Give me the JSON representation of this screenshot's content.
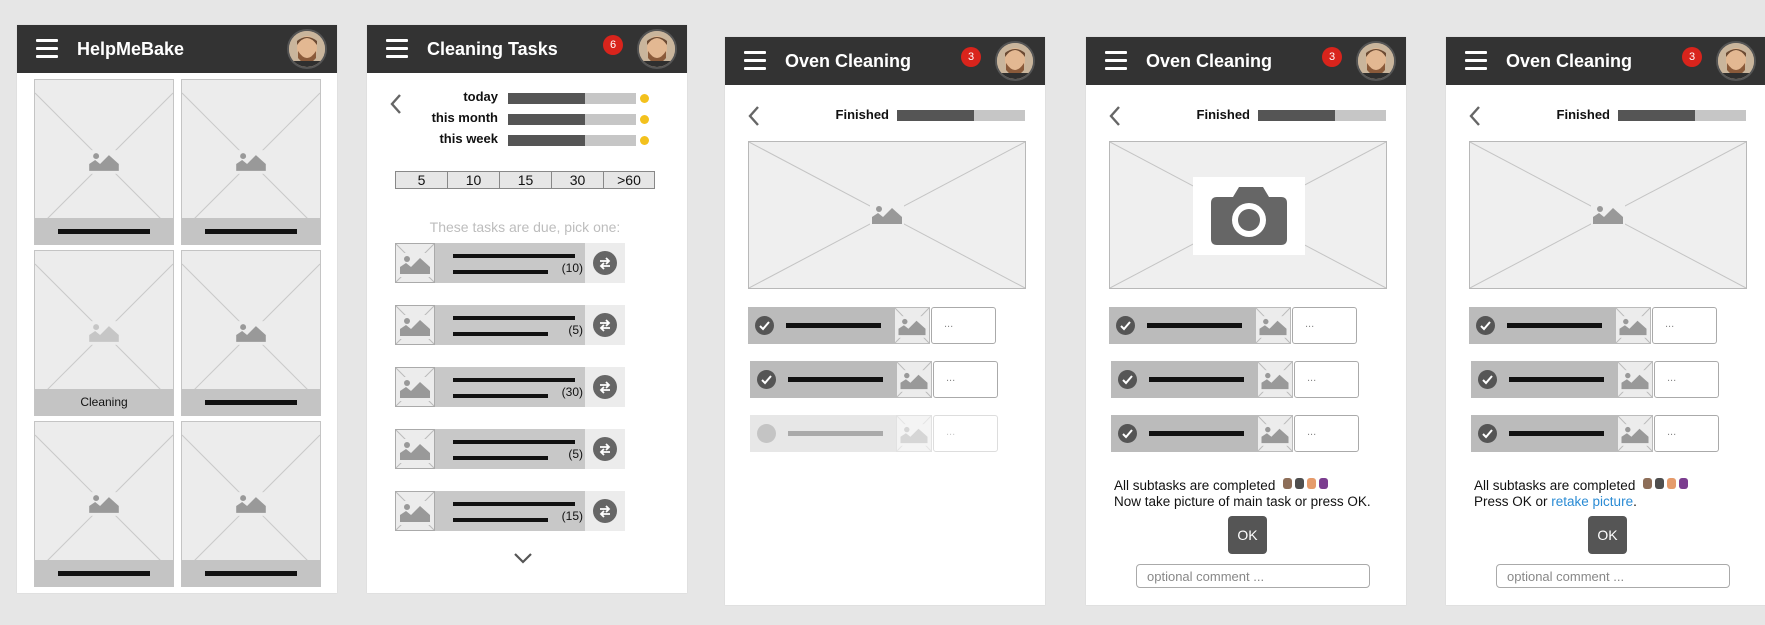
{
  "screen1": {
    "title": "HelpMeBake",
    "tiles": [
      {
        "caption": ""
      },
      {
        "caption": ""
      },
      {
        "caption": "Cleaning"
      },
      {
        "caption": ""
      },
      {
        "caption": ""
      },
      {
        "caption": ""
      }
    ]
  },
  "screen2": {
    "title": "Cleaning Tasks",
    "badge": "6",
    "progress": [
      {
        "label": "today",
        "fraction": 0.6
      },
      {
        "label": "this month",
        "fraction": 0.6
      },
      {
        "label": "this week",
        "fraction": 0.6
      }
    ],
    "durations": [
      "5",
      "10",
      "15",
      "30",
      ">60"
    ],
    "due_prompt": "These tasks are due, pick one:",
    "tasks": [
      {
        "count": "(10)"
      },
      {
        "count": "(5)"
      },
      {
        "count": "(30)"
      },
      {
        "count": "(5)"
      },
      {
        "count": "(15)"
      }
    ]
  },
  "screen3": {
    "title": "Oven Cleaning",
    "badge": "3",
    "finished_label": "Finished",
    "finished_fraction": 0.6,
    "comment_placeholder": "..."
  },
  "screen4": {
    "title": "Oven Cleaning",
    "badge": "3",
    "finished_label": "Finished",
    "finished_fraction": 0.6,
    "message_line1": "All subtasks are completed",
    "message_line2": "Now take picture of main task or press OK.",
    "ok_label": "OK",
    "comment_placeholder": "optional comment ...",
    "sub_placeholder": "..."
  },
  "screen5": {
    "title": "Oven Cleaning",
    "badge": "3",
    "finished_label": "Finished",
    "finished_fraction": 0.6,
    "message_line1": "All subtasks are completed",
    "message_line2_prefix": "Press OK or ",
    "retake_link": "retake picture",
    "message_line2_suffix": ".",
    "ok_label": "OK",
    "comment_placeholder": "optional comment ...",
    "sub_placeholder": "..."
  },
  "colors": {
    "header": "#333333",
    "badge": "#d9241c",
    "link": "#2a8bd4",
    "ok_button": "#555555"
  },
  "icons": [
    "menu-icon",
    "avatar",
    "image-placeholder-icon",
    "back-arrow-icon",
    "swap-icon",
    "chevron-down-icon",
    "check-icon",
    "camera-icon",
    "smiley-icon"
  ]
}
